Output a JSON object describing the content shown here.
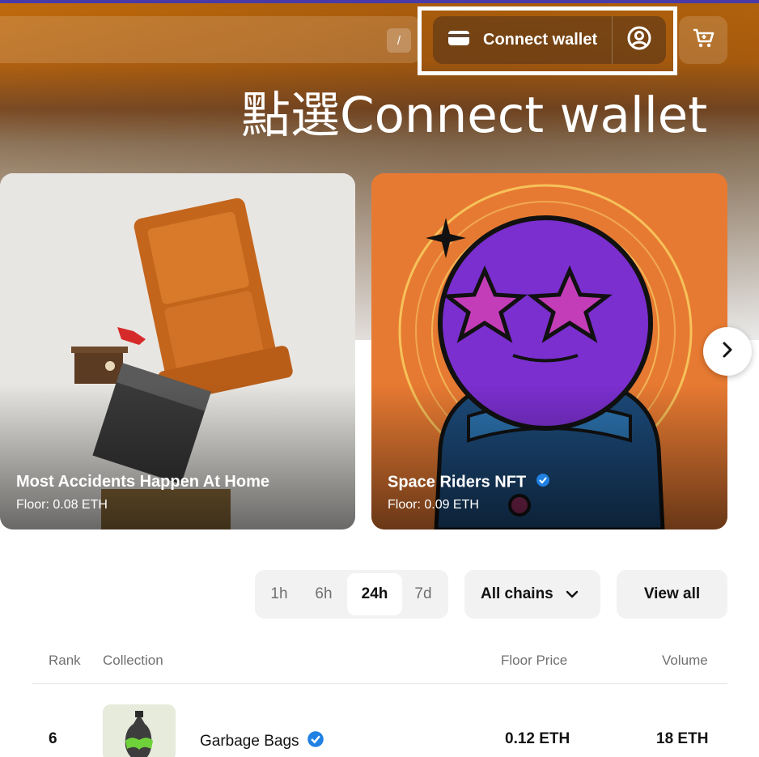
{
  "header": {
    "search_shortcut": "/",
    "connect_wallet_label": "Connect wallet",
    "instruction_text": "點選Connect wallet"
  },
  "carousel": {
    "cards": [
      {
        "title": "Most Accidents Happen At Home",
        "floor": "Floor: 0.08 ETH",
        "verified": false
      },
      {
        "title": "Space Riders NFT",
        "floor": "Floor: 0.09 ETH",
        "verified": true
      }
    ]
  },
  "filters": {
    "time_options": [
      {
        "label": "1h",
        "active": false
      },
      {
        "label": "6h",
        "active": false
      },
      {
        "label": "24h",
        "active": true
      },
      {
        "label": "7d",
        "active": false
      }
    ],
    "chains_label": "All chains",
    "view_all_label": "View all"
  },
  "table": {
    "headers": {
      "rank": "Rank",
      "collection": "Collection",
      "floor": "Floor Price",
      "volume": "Volume"
    },
    "rows": [
      {
        "rank": "6",
        "collection": "Garbage Bags",
        "verified": true,
        "floor": "0.12 ETH",
        "volume": "18 ETH"
      }
    ]
  },
  "colors": {
    "accent_highlight": "#ffffff",
    "verified_blue": "#2081e2",
    "hero_orange": "#c06a0c"
  }
}
